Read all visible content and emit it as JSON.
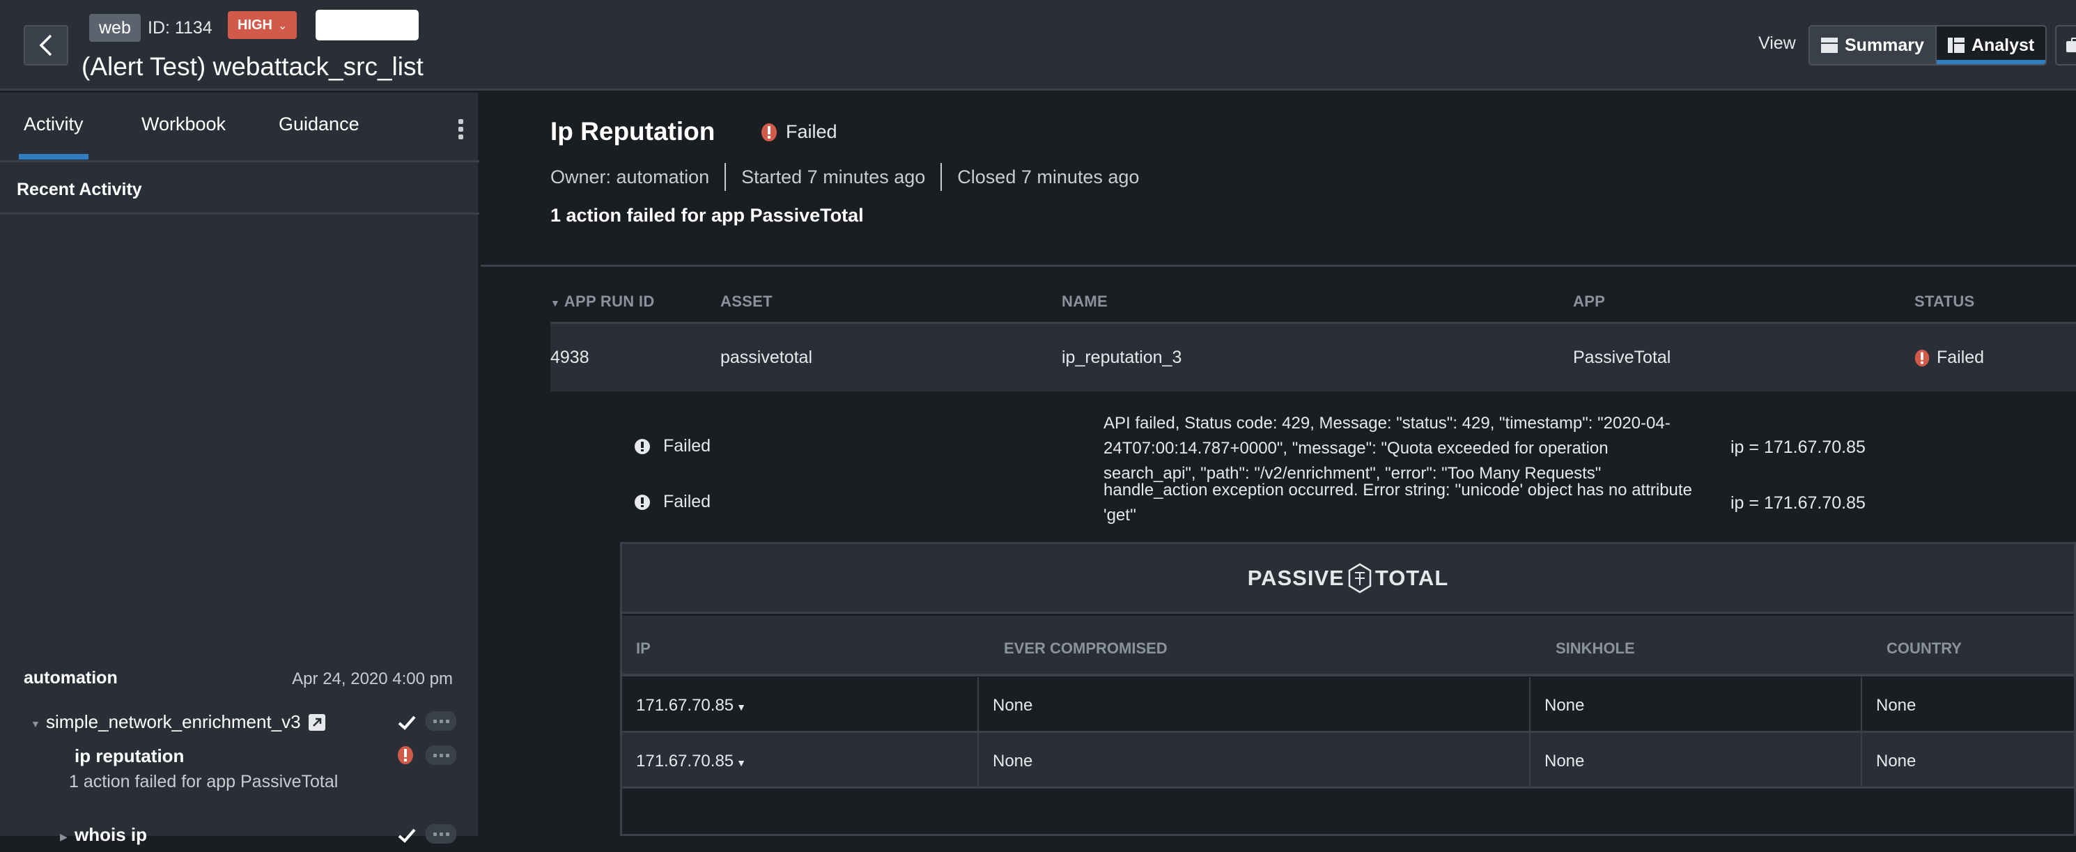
{
  "header": {
    "tag": "web",
    "id_label": "ID: 1134",
    "severity": "HIGH",
    "title": "(Alert Test) webattack_src_list",
    "view_label": "View",
    "view_options": [
      {
        "label": "Summary",
        "icon": "summary-layout-icon",
        "active": false
      },
      {
        "label": "Analyst",
        "icon": "analyst-layout-icon",
        "active": true
      }
    ]
  },
  "left_panel": {
    "tabs": [
      {
        "label": "Activity",
        "active": true
      },
      {
        "label": "Workbook",
        "active": false
      },
      {
        "label": "Guidance",
        "active": false
      }
    ],
    "section_title": "Recent Activity",
    "activity": {
      "user": "automation",
      "timestamp": "Apr 24, 2020 4:00 pm",
      "playbook": {
        "name": "simple_network_enrichment_v3",
        "status": "success"
      },
      "items": [
        {
          "name": "ip reputation",
          "status": "failed",
          "message": "1 action failed for app PassiveTotal"
        },
        {
          "name": "whois ip",
          "status": "success"
        }
      ]
    }
  },
  "main": {
    "title": "Ip Reputation",
    "status": "Failed",
    "status_color": "#d25a4a",
    "owner": "Owner: automation",
    "started": "Started 7 minutes ago",
    "closed": "Closed 7 minutes ago",
    "summary": "1 action failed for app PassiveTotal",
    "table": {
      "columns": [
        "APP RUN ID",
        "ASSET",
        "NAME",
        "APP",
        "STATUS"
      ],
      "rows": [
        {
          "run_id": "4938",
          "asset": "passivetotal",
          "name": "ip_reputation_3",
          "app": "PassiveTotal",
          "status": "Failed"
        }
      ]
    },
    "results": [
      {
        "status": "Failed",
        "message": "API failed, Status code: 429, Message: \"status\": 429, \"timestamp\": \"2020-04-24T07:00:14.787+0000\", \"message\": \"Quota exceeded for operation search_api\", \"path\": \"/v2/enrichment\", \"error\": \"Too Many Requests\"",
        "param": "ip = 171.67.70.85"
      },
      {
        "status": "Failed",
        "message": "handle_action exception occurred. Error string: ''unicode' object has no attribute 'get''",
        "param": "ip = 171.67.70.85"
      }
    ],
    "widget": {
      "logo_left": "PASSIVE",
      "logo_right": "TOTAL",
      "columns": [
        "IP",
        "EVER COMPROMISED",
        "SINKHOLE",
        "COUNTRY"
      ],
      "rows": [
        {
          "ip": "171.67.70.85",
          "ever_compromised": "None",
          "sinkhole": "None",
          "country": "None"
        },
        {
          "ip": "171.67.70.85",
          "ever_compromised": "None",
          "sinkhole": "None",
          "country": "None"
        }
      ]
    }
  }
}
